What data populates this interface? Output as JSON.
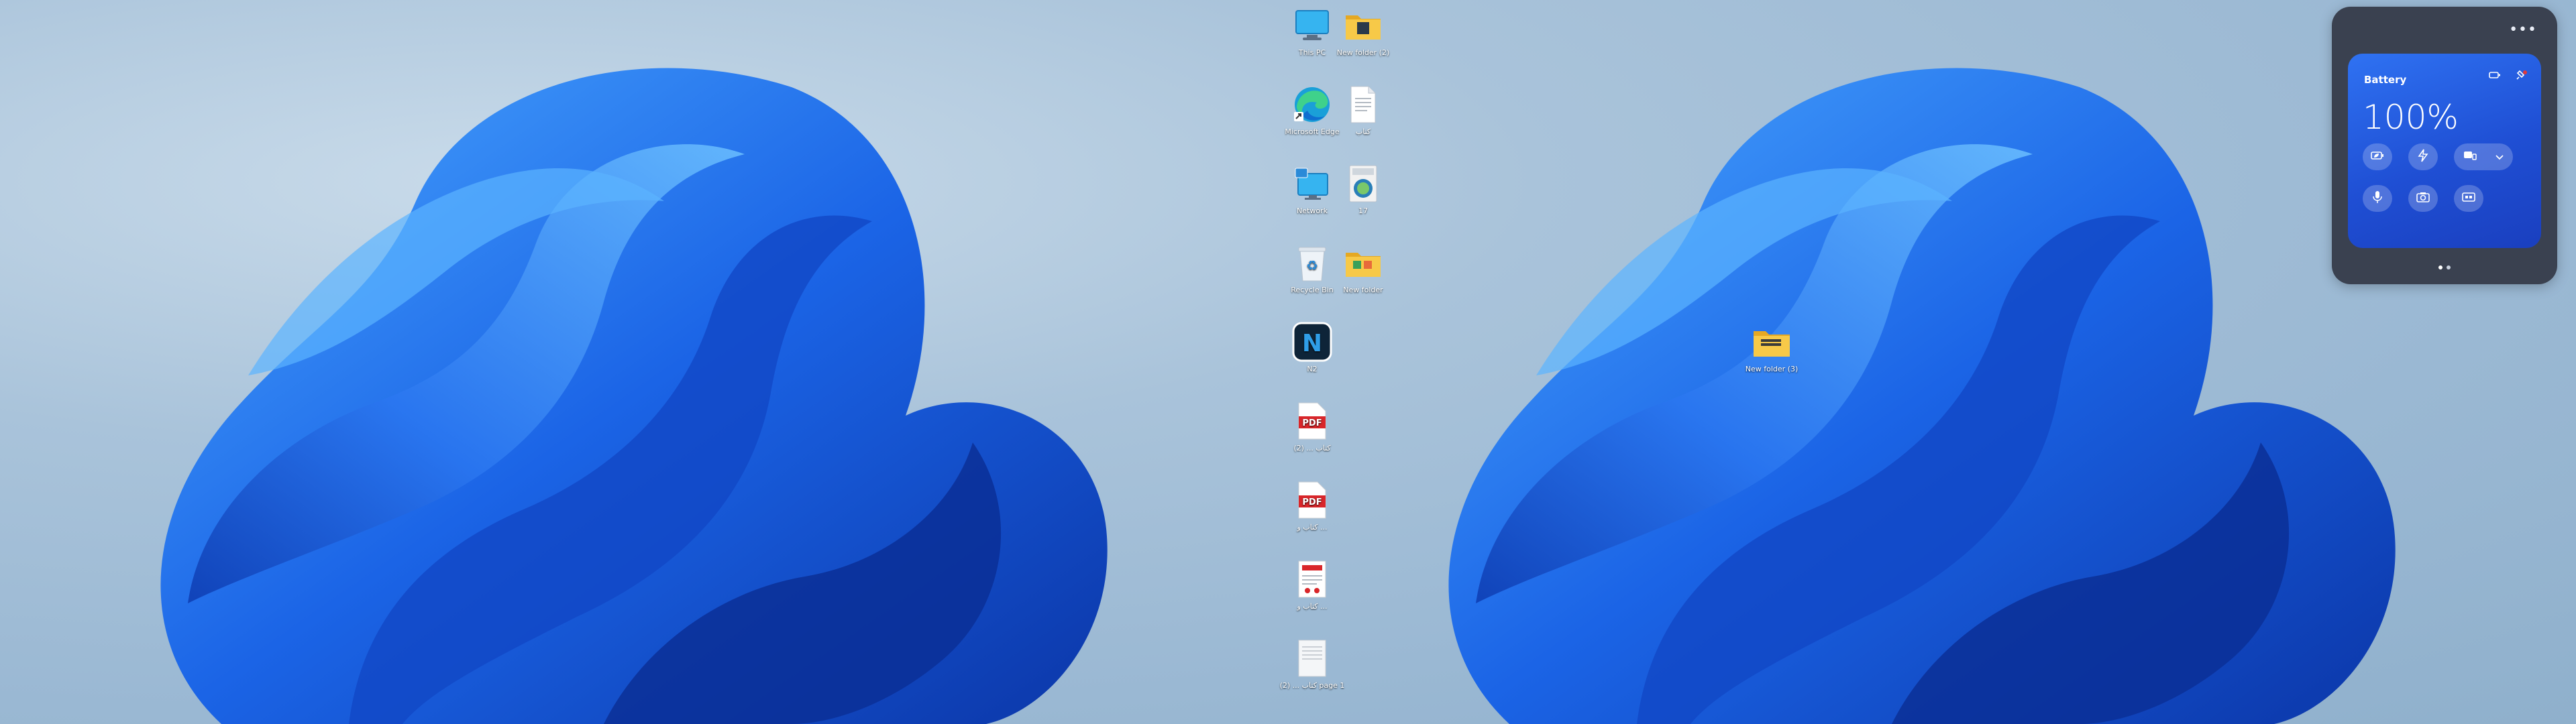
{
  "desktop_icons": [
    {
      "id": "this-pc",
      "label": "This PC"
    },
    {
      "id": "new-folder-2",
      "label": "New folder (2)"
    },
    {
      "id": "edge",
      "label": "Microsoft Edge"
    },
    {
      "id": "doc-arabic",
      "label": "كتاب"
    },
    {
      "id": "network",
      "label": "Network"
    },
    {
      "id": "app-17",
      "label": "17"
    },
    {
      "id": "recycle-bin",
      "label": "Recycle Bin"
    },
    {
      "id": "new-folder",
      "label": "New folder"
    },
    {
      "id": "app-n",
      "label": "N2"
    },
    {
      "id": "pdf-1",
      "label": "كتاب ... (2)"
    },
    {
      "id": "pdf-2",
      "label": "كتاب و ..."
    },
    {
      "id": "doc-2",
      "label": "كتاب و ..."
    },
    {
      "id": "doc-3",
      "label": "كتاب ... (2) page 1"
    },
    {
      "id": "new-folder-3",
      "label": "New folder (3)"
    }
  ],
  "widget": {
    "more_label": "•••",
    "title": "Battery",
    "percent": "100%",
    "pager_count": 2,
    "pager_active": 0
  },
  "colors": {
    "card_blue": "#2f72f2",
    "frame": "#3a4150",
    "wallpaper_blue": "#1e63e0"
  }
}
